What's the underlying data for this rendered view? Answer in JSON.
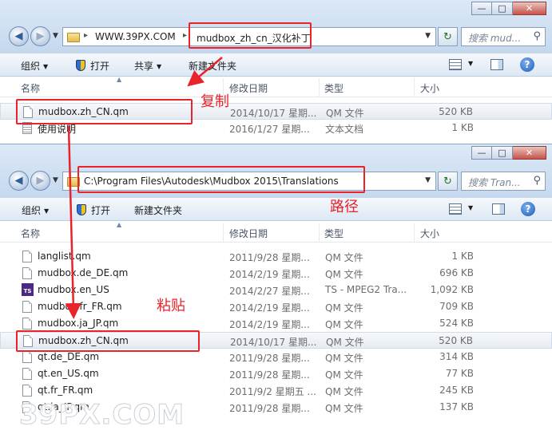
{
  "window1": {
    "breadcrumb": {
      "parent": "WWW.39PX.COM",
      "current": "mudbox_zh_cn_汉化补丁"
    },
    "search_placeholder": "搜索 mud...",
    "toolbar": {
      "organize": "组织",
      "open": "打开",
      "share": "共享",
      "new_folder": "新建文件夹"
    },
    "columns": {
      "name": "名称",
      "date": "修改日期",
      "type": "类型",
      "size": "大小"
    },
    "files": [
      {
        "name": "mudbox.zh_CN.qm",
        "date": "2014/10/17 星期...",
        "type": "QM 文件",
        "size": "520 KB",
        "icon": "file-icon",
        "selected": true
      },
      {
        "name": "使用说明",
        "date": "2016/1/27 星期...",
        "type": "文本文档",
        "size": "1 KB",
        "icon": "text-file-icon",
        "selected": false
      }
    ]
  },
  "window2": {
    "address": "C:\\Program Files\\Autodesk\\Mudbox 2015\\Translations",
    "search_placeholder": "搜索 Tran...",
    "toolbar": {
      "organize": "组织",
      "open": "打开",
      "new_folder": "新建文件夹"
    },
    "columns": {
      "name": "名称",
      "date": "修改日期",
      "type": "类型",
      "size": "大小"
    },
    "files": [
      {
        "name": "langlist.qm",
        "date": "2011/9/28 星期...",
        "type": "QM 文件",
        "size": "1 KB",
        "icon": "file-icon",
        "selected": false
      },
      {
        "name": "mudbox.de_DE.qm",
        "date": "2014/2/19 星期...",
        "type": "QM 文件",
        "size": "696 KB",
        "icon": "file-icon",
        "selected": false
      },
      {
        "name": "mudbox.en_US",
        "date": "2014/2/27 星期...",
        "type": "TS - MPEG2 Tra...",
        "size": "1,092 KB",
        "icon": "ts-icon",
        "selected": false
      },
      {
        "name": "mudbox.fr_FR.qm",
        "date": "2014/2/19 星期...",
        "type": "QM 文件",
        "size": "709 KB",
        "icon": "file-icon",
        "selected": false
      },
      {
        "name": "mudbox.ja_JP.qm",
        "date": "2014/2/19 星期...",
        "type": "QM 文件",
        "size": "524 KB",
        "icon": "file-icon",
        "selected": false
      },
      {
        "name": "mudbox.zh_CN.qm",
        "date": "2014/10/17 星期...",
        "type": "QM 文件",
        "size": "520 KB",
        "icon": "file-icon",
        "selected": true
      },
      {
        "name": "qt.de_DE.qm",
        "date": "2011/9/28 星期...",
        "type": "QM 文件",
        "size": "314 KB",
        "icon": "file-icon",
        "selected": false
      },
      {
        "name": "qt.en_US.qm",
        "date": "2011/9/28 星期...",
        "type": "QM 文件",
        "size": "77 KB",
        "icon": "file-icon",
        "selected": false
      },
      {
        "name": "qt.fr_FR.qm",
        "date": "2011/9/2 星期五 ...",
        "type": "QM 文件",
        "size": "245 KB",
        "icon": "file-icon",
        "selected": false
      },
      {
        "name": "qt.ja_JP.qm",
        "date": "2011/9/28 星期...",
        "type": "QM 文件",
        "size": "137 KB",
        "icon": "file-icon",
        "selected": false
      }
    ]
  },
  "annotations": {
    "copy": "复制",
    "path": "路径",
    "paste": "粘贴",
    "color": "#e8232a"
  },
  "watermark": "39PX.COM"
}
